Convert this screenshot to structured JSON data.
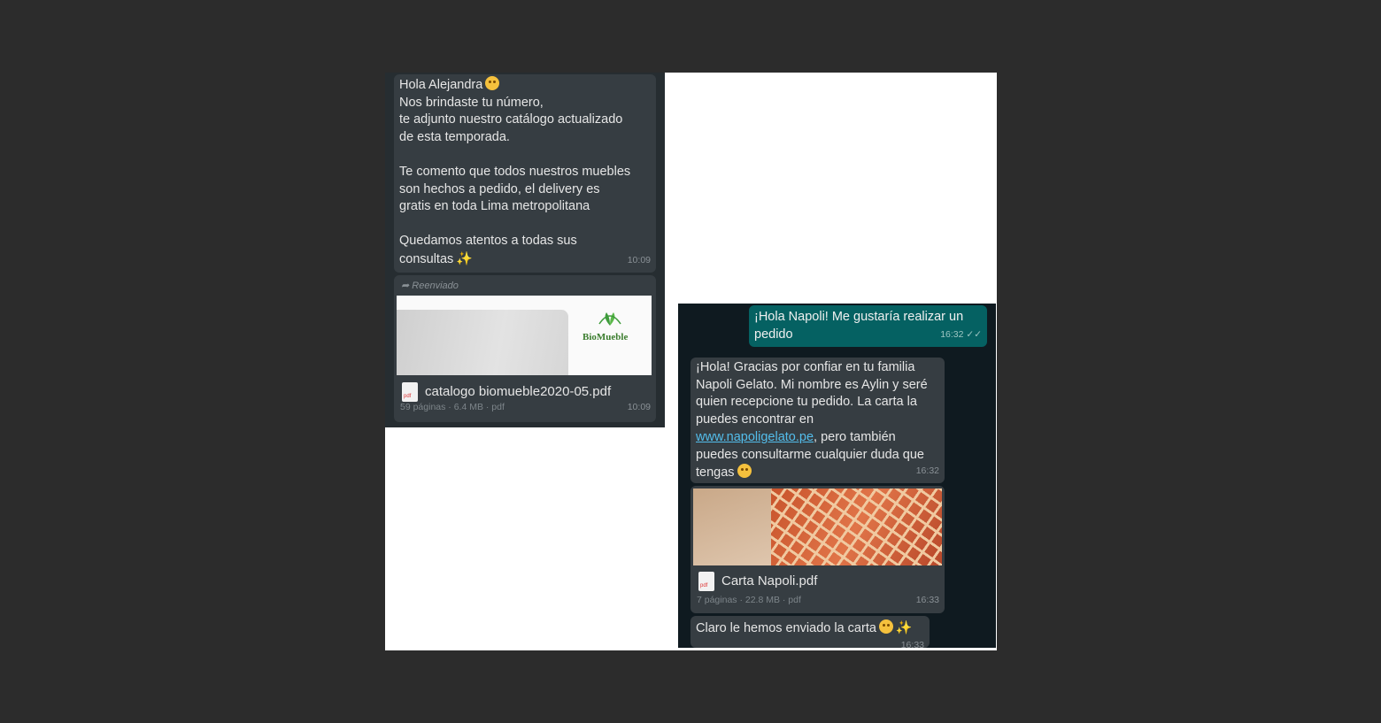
{
  "left_chat": {
    "message1": {
      "line1": "Hola Alejandra",
      "line2": "Nos brindaste tu número,",
      "line3": "te adjunto nuestro catálogo actualizado",
      "line4": "de esta temporada.",
      "para2_line1": "Te comento que todos nuestros muebles",
      "para2_line2": "son hechos a pedido, el delivery es",
      "para2_line3": "gratis en toda Lima metropolitana",
      "para3_line1": "Quedamos atentos a todas sus",
      "para3_line2": "consultas",
      "time": "10:09"
    },
    "forwarded_label": "Reenviado",
    "document": {
      "brand_logo_text": "BioMueble",
      "filename": "catalogo biomueble2020-05.pdf",
      "meta": "59 páginas · 6.4 MB · pdf",
      "time": "10:09"
    }
  },
  "right_chat": {
    "outgoing": {
      "line1": "¡Hola Napoli! Me gustaría realizar un",
      "line2": "pedido",
      "time": "16:32"
    },
    "incoming1": {
      "line1": "¡Hola! Gracias por confiar en tu familia",
      "line2": "Napoli Gelato. Mi nombre es Aylin y seré",
      "line3": "quien recepcione tu pedido. La carta la",
      "line4": "puedes encontrar en",
      "link": "www.napoligelato.pe",
      "line5_rest": ", pero también",
      "line6": "puedes consultarme cualquier duda que",
      "line7": "tengas",
      "time": "16:32"
    },
    "document": {
      "filename": "Carta Napoli.pdf",
      "meta": "7 páginas · 22.8 MB · pdf",
      "time": "16:33"
    },
    "incoming2": {
      "text": "Claro le hemos enviado la carta",
      "time": "16:33"
    }
  },
  "colors": {
    "outgoing_bubble": "#056162",
    "incoming_bubble": "#363d42",
    "link": "#53bdeb"
  }
}
